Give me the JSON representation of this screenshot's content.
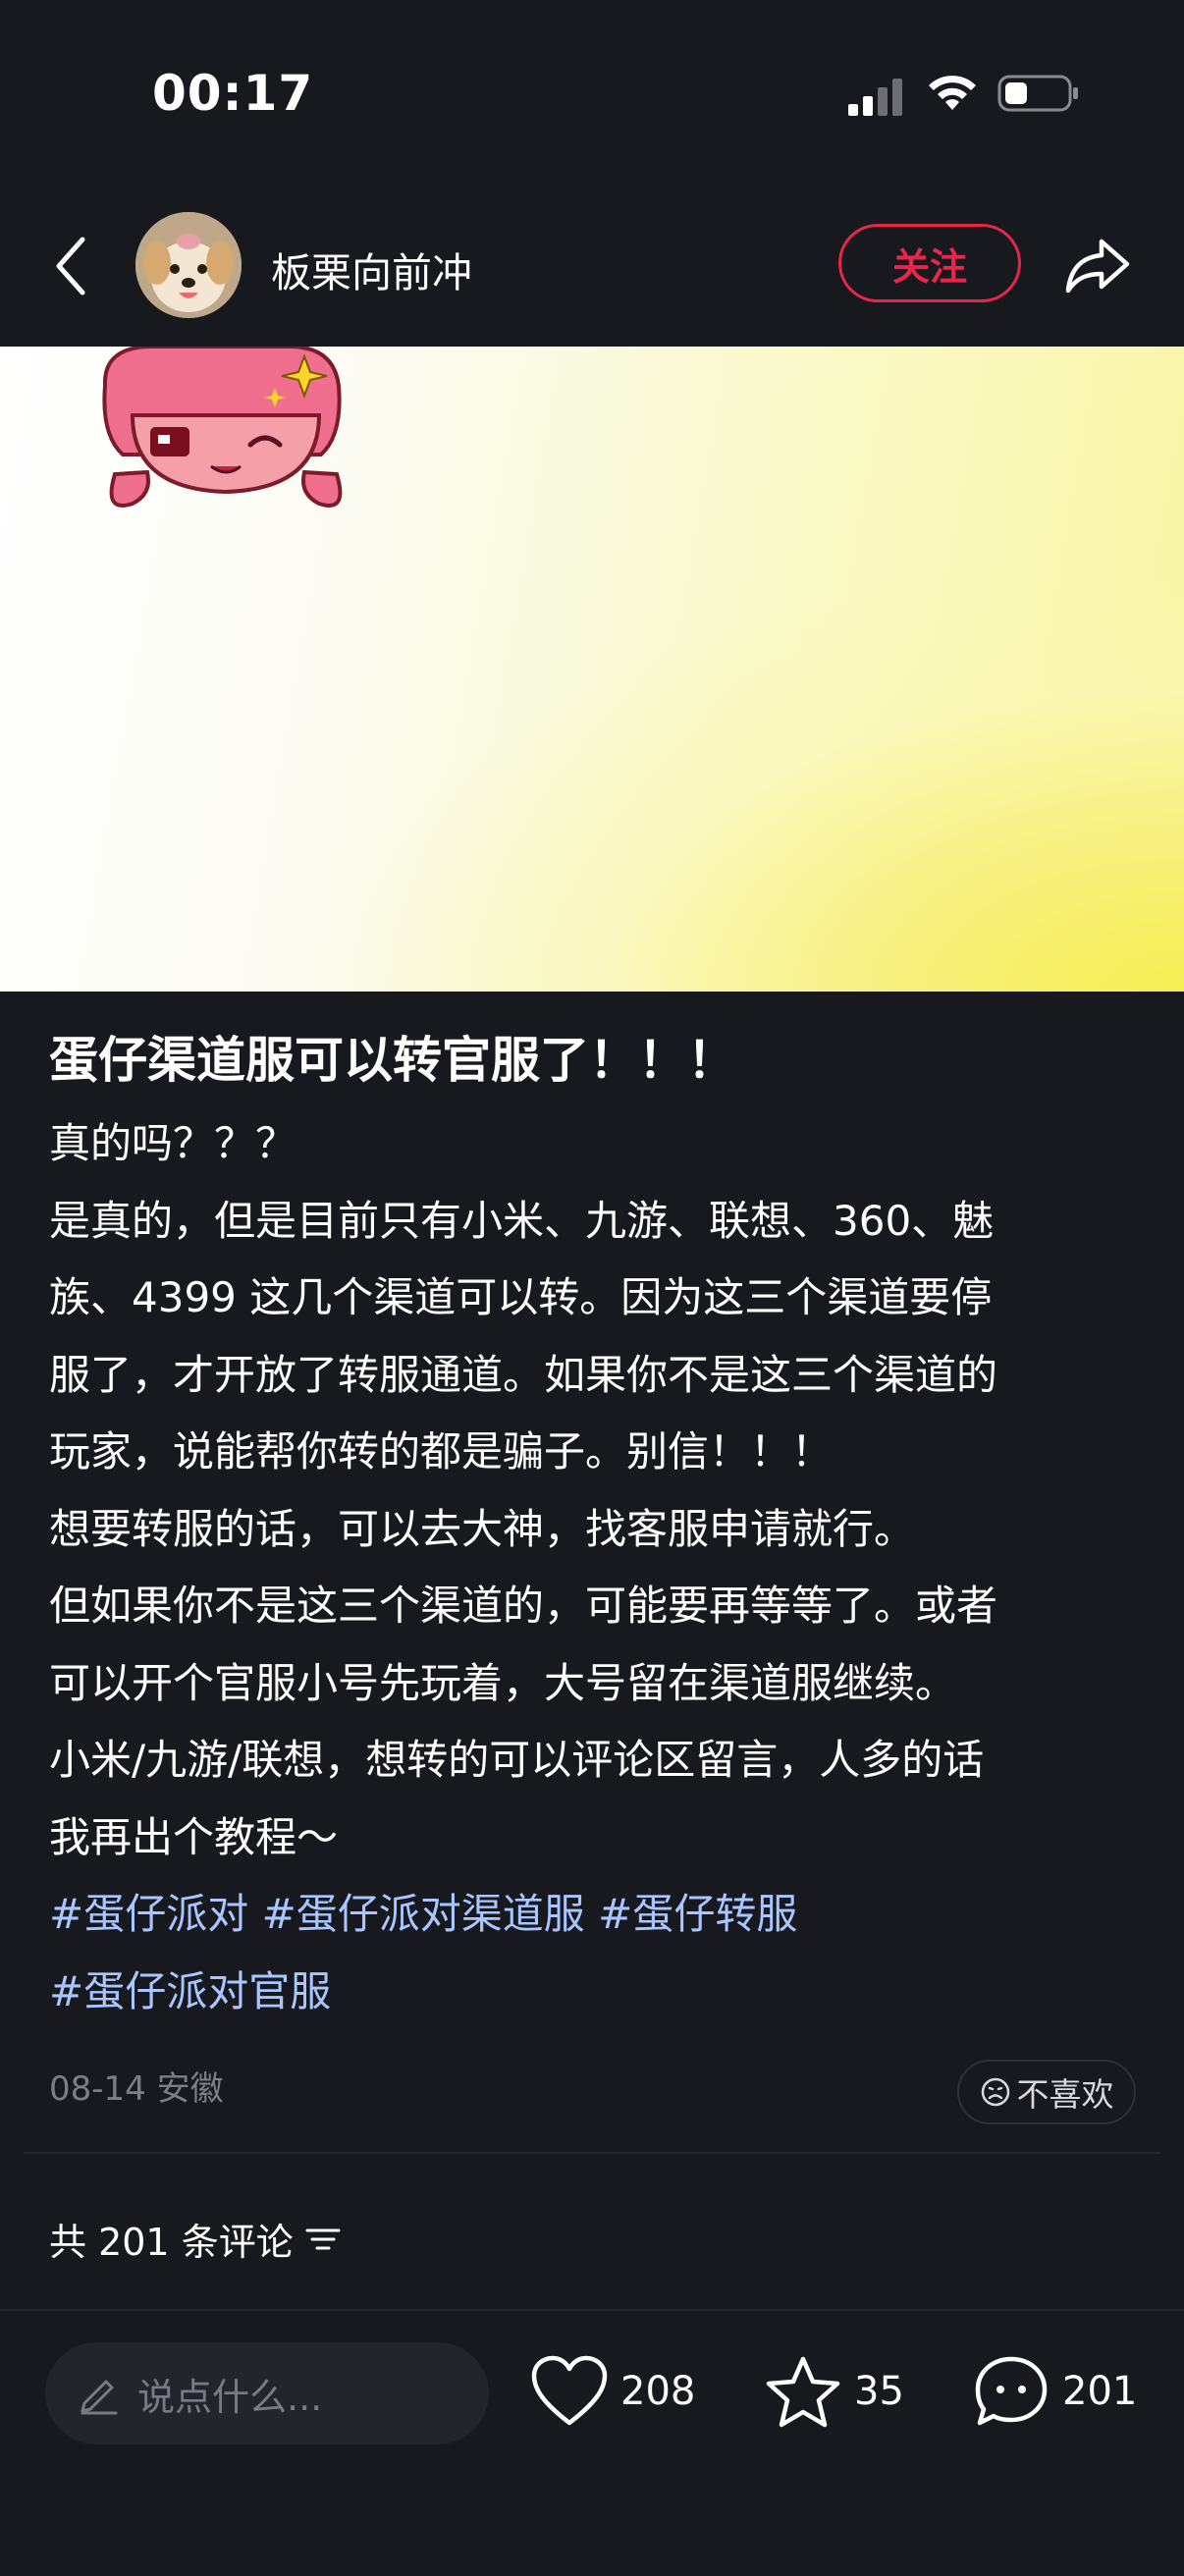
{
  "status_bar": {
    "time": "00:17",
    "icons": [
      "cellular-signal-icon",
      "wifi-icon",
      "battery-icon"
    ]
  },
  "header": {
    "username": "板栗向前冲",
    "follow_label": "关注",
    "icons": [
      "back-icon",
      "avatar",
      "share-icon"
    ],
    "accent_color": "#e8264a"
  },
  "post": {
    "title": "蛋仔渠道服可以转官服了！！！",
    "body_lines": [
      "真的吗？？？",
      "是真的，但是目前只有小米、九游、联想、360、魅",
      "族、4399 这几个渠道可以转。因为这三个渠道要停",
      "服了，才开放了转服通道。如果你不是这三个渠道的",
      "玩家，说能帮你转的都是骗子。别信！！！",
      "想要转服的话，可以去大神，找客服申请就行。",
      "但如果你不是这三个渠道的，可能要再等等了。或者",
      "可以开个官服小号先玩着，大号留在渠道服继续。",
      "小米/九游/联想，想转的可以评论区留言，人多的话",
      "我再出个教程～"
    ],
    "tags": [
      "#蛋仔派对",
      "#蛋仔派对渠道服",
      "#蛋仔转服",
      "#蛋仔派对官服"
    ],
    "tag_color": "#a8c6ff",
    "meta": "08-14 安徽",
    "dislike_label": "不喜欢"
  },
  "comments": {
    "count_label": "共 201 条评论"
  },
  "bottom_bar": {
    "input_placeholder": "说点什么...",
    "like_count": "208",
    "favorite_count": "35",
    "comment_count": "201"
  }
}
